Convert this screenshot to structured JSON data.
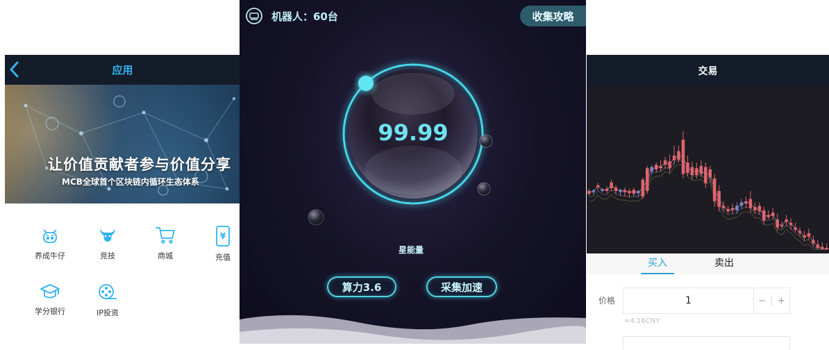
{
  "left_panel": {
    "nav": {
      "title": "应用",
      "back_icon": "chevron-left-icon"
    },
    "banner": {
      "headline": "让价值贡献者参与价值分享",
      "subline": "MCB全球首个区块链内循环生态体系"
    },
    "apps": [
      {
        "label": "养成牛仔",
        "icon": "cow-face-icon"
      },
      {
        "label": "竞技",
        "icon": "bull-head-icon"
      },
      {
        "label": "商城",
        "icon": "shopping-cart-icon"
      },
      {
        "label": "充值",
        "icon": "phone-recharge-icon"
      },
      {
        "label": "学分银行",
        "icon": "graduation-cap-icon"
      },
      {
        "label": "IP投资",
        "icon": "film-reel-icon"
      }
    ],
    "accent_color": "#2fb4ef"
  },
  "middle_panel": {
    "robot_label": "机器人：60台",
    "collect_guide_label": "收集攻略",
    "orb_value": "99.99",
    "energy_label": "星能量",
    "compute_power_label": "算力3.6",
    "collect_speedup_label": "采集加速",
    "accent_color": "#4fd6e4"
  },
  "right_panel": {
    "nav": {
      "title": "交易"
    },
    "tabs": [
      {
        "label": "买入",
        "active": true
      },
      {
        "label": "卖出",
        "active": false
      }
    ],
    "price_label": "价格",
    "price_value": "1",
    "stepper_minus": "−",
    "stepper_plus": "+",
    "price_hint": "≈4.16CNY",
    "candle_up_color": "#7f83c9",
    "candle_down_color": "#e0646f"
  }
}
